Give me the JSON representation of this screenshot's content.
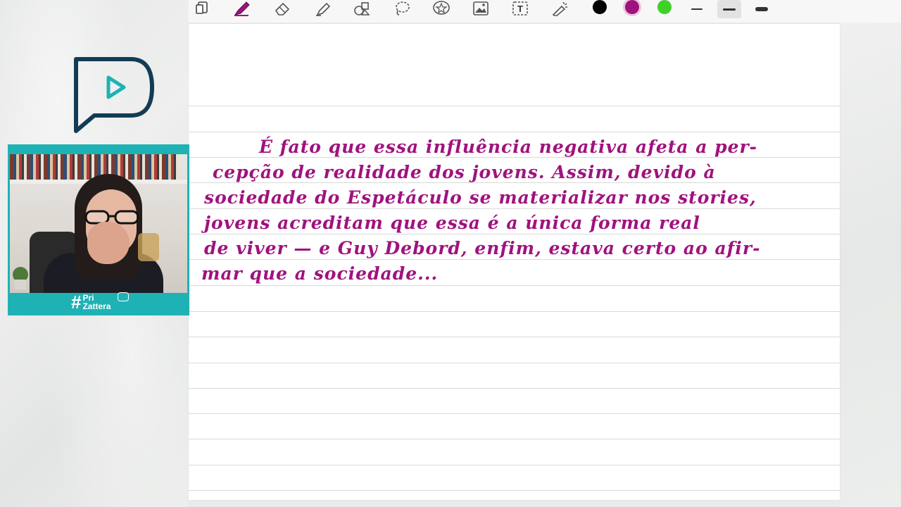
{
  "toolbar": {
    "tools": [
      {
        "name": "pages-icon"
      },
      {
        "name": "pen-icon",
        "active": true
      },
      {
        "name": "eraser-icon"
      },
      {
        "name": "highlighter-icon"
      },
      {
        "name": "shapes-icon"
      },
      {
        "name": "lasso-icon"
      },
      {
        "name": "sticker-icon"
      },
      {
        "name": "image-icon"
      },
      {
        "name": "text-icon",
        "label": "T"
      },
      {
        "name": "laser-pointer-icon"
      }
    ],
    "colors": [
      "#000000",
      "#a0127e",
      "#3fd12a"
    ],
    "selected_color": "#a0127e",
    "stroke_widths": [
      "thin",
      "medium",
      "thick"
    ],
    "selected_stroke": "medium"
  },
  "note": {
    "lines": [
      "É fato que essa influência negativa afeta a per-",
      "cepção de realidade dos jovens. Assim, devido à",
      "sociedade do Espetáculo se materializar nos stories,",
      "jovens acreditam que essa é a única forma real",
      "de viver — e Guy Debord, enfim, estava certo ao afir-",
      "mar que a sociedade..."
    ],
    "ink_color": "#a0127e"
  },
  "webcam": {
    "brand_hash": "#",
    "brand_line1": "Pri",
    "brand_line2": "Zattera",
    "frame_color": "#1fb2b5"
  },
  "logo": {
    "color_outline": "#123c55",
    "color_play": "#1fb2b5"
  }
}
